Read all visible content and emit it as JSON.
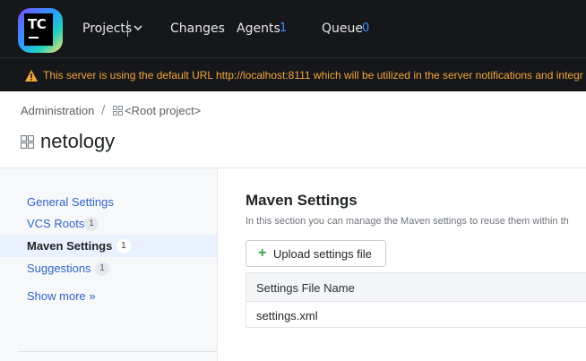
{
  "header": {
    "logo_text": "TC",
    "nav": {
      "projects": "Projects",
      "changes": "Changes",
      "agents": "Agents",
      "agents_count": "1",
      "queue": "Queue",
      "queue_count": "0"
    },
    "warning": "This server is using the default URL http://localhost:8111 which will be utilized in the server notifications and integr"
  },
  "breadcrumb": {
    "admin": "Administration",
    "separator": "/",
    "root": "<Root project>"
  },
  "page_title": "netology",
  "sidebar": {
    "items": [
      {
        "label": "General Settings",
        "badge": ""
      },
      {
        "label": "VCS Roots",
        "badge": "1"
      },
      {
        "label": "Maven Settings",
        "badge": "1"
      },
      {
        "label": "Suggestions",
        "badge": "1"
      }
    ],
    "active": "Maven Settings",
    "show_more": "Show more »"
  },
  "main": {
    "title": "Maven Settings",
    "description": "In this section you can manage the Maven settings to reuse them within th",
    "upload_button": "Upload settings file",
    "table": {
      "header": "Settings File Name",
      "rows": [
        "settings.xml"
      ]
    }
  },
  "colors": {
    "topbar": "#16171a",
    "warning": "#f3a43a",
    "accent_blue": "#3a8dff",
    "link": "#2f63c7",
    "active_bg": "#e9f1ff",
    "plus_green": "#3aa346"
  },
  "icons": [
    "teamcity-logo",
    "chevron-down-icon",
    "warning-icon",
    "project-grid-icon",
    "plus-icon"
  ]
}
